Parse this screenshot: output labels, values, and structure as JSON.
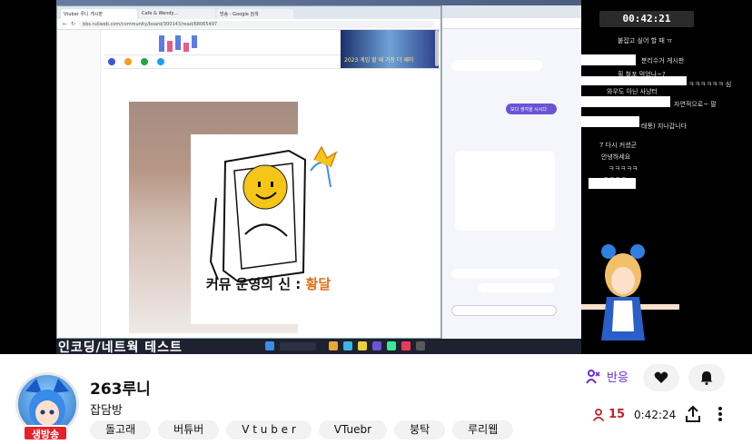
{
  "stream": {
    "clock": "00:42:21",
    "subtitle_bar": "인코딩/네트웍 테스트",
    "drawing_caption_prefix": "커뮤 운영의 신 : ",
    "drawing_caption_highlight": "황달",
    "browser": {
      "tabs": [
        "Vtuber 루니 게시판",
        "Cafe & Wendy…",
        "방송 - Google 검색"
      ],
      "url": "bbs.ruliweb.com/community/board/300143/read/68065497",
      "banner_text": "2023 게임 할 때 가장 더 재미"
    },
    "chat_lines": [
      "붙잡고 싶어 할 때 ㅠ",
      "분리수거 게시판",
      "휠 철포 먹었나~?",
      "ㅋㅋㅋㅋㅋㅋ 심",
      "와우도 아닌 사냥터",
      "자연적으로~ 팔",
      "태풍) 지나갑니다",
      "7 다시 커셨군",
      "안녕하세요",
      "ㅋㅋㅋㅋㅋ",
      "ㅋㅋㅋㅋ"
    ],
    "ai_chat_button": "보다 생각을 시시다"
  },
  "channel": {
    "name": "263루니",
    "category": "잡담방",
    "live_badge": "생방송",
    "tags": [
      "돌고래",
      "버튜버",
      "V t u b e r",
      "VTuebr",
      "붕탁",
      "루리웹"
    ],
    "reaction_label": "반응",
    "viewer_count": "15",
    "elapsed": "0:42:24"
  },
  "colors": {
    "accent_purple": "#6a2bd8",
    "live_red": "#e2232b",
    "viewer_red": "#c0212b",
    "caption_highlight": "#e26f17"
  }
}
